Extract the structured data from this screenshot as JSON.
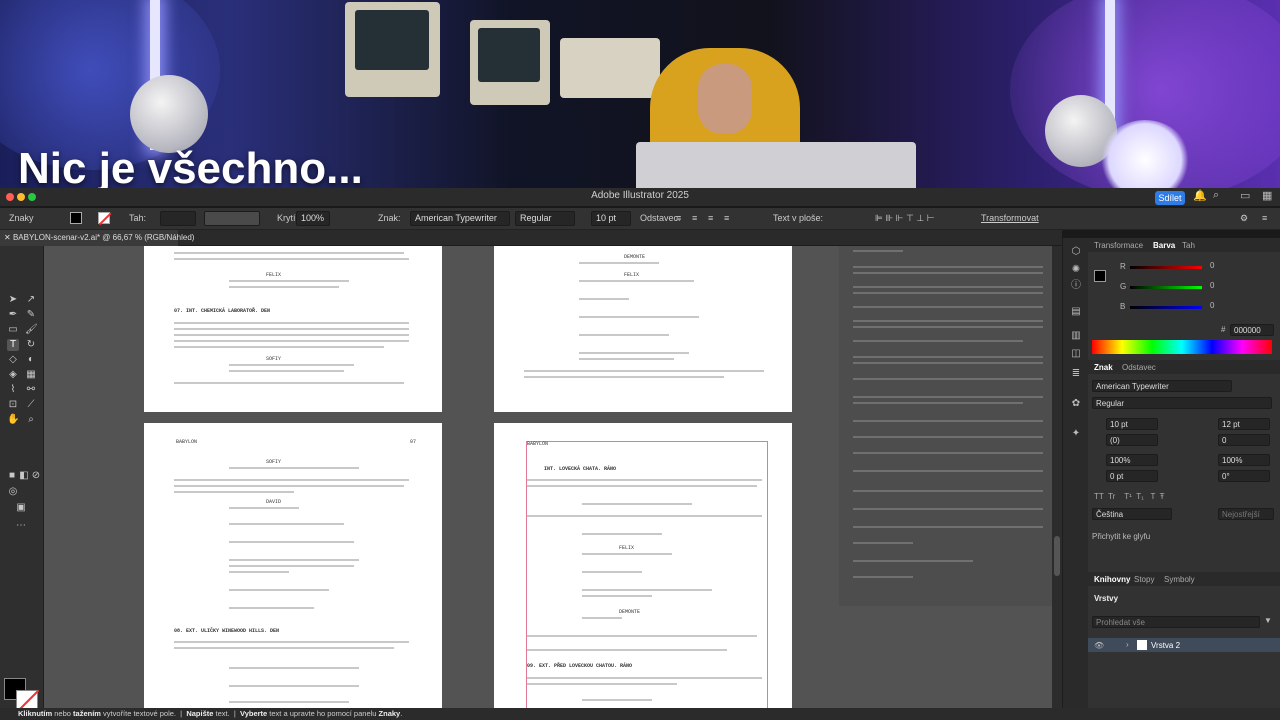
{
  "overlay": {
    "caption": "Nic je všechno..."
  },
  "window": {
    "title": "Adobe Illustrator 2025",
    "share_label": "Sdílet"
  },
  "control_bar": {
    "panel_name": "Znaky",
    "stroke_label": "Tah:",
    "opacity_label": "Krytí:",
    "opacity_value": "100%",
    "char_label": "Znak:",
    "font_name": "American Typewriter",
    "font_style": "Regular",
    "font_size": "10 pt",
    "paragraph_label": "Odstavec:",
    "area_text_label": "Text v ploše:",
    "transform_label": "Transformovat"
  },
  "document": {
    "tab_title": "BABYLON-scenar-v2.ai* @ 66,67 % (RGB/Náhled)"
  },
  "script_pages": {
    "p1_scene": "07.   INT. CHEMICKÁ LABORATOŘ. DEN",
    "p1_char1": "FELIX",
    "p1_char2": "SOFIY",
    "p2_char1": "DEMONTE",
    "p2_char2": "FELIX",
    "p3_header": "BABYLON",
    "p3_page": "07",
    "p3_char1": "SOFIY",
    "p3_char2": "DAVID",
    "p3_scene": "08.   EXT. ULIČKY WINEWOOD HILLS. DEN",
    "p4_header": "BABYLON",
    "p4_scene": "INT. LOVECKÁ CHATA. RÁNO",
    "p4_char1": "FELIX",
    "p4_char2": "DEMONTE",
    "p4_scene2": "09.   EXT. PŘED LOVECKOU CHATOU. RÁNO"
  },
  "panels": {
    "tabs": [
      "Transformace",
      "Barva",
      "Tah"
    ],
    "color": {
      "r_label": "R",
      "g_label": "G",
      "b_label": "B",
      "r": "0",
      "g": "0",
      "b": "0",
      "hex_prefix": "#",
      "hex": "000000"
    },
    "type_tabs": [
      "Znak",
      "Odstavec"
    ],
    "character": {
      "font": "American Typewriter",
      "style": "Regular",
      "size": "10 pt",
      "leading": "12 pt",
      "kerning": "(0)",
      "tracking": "0",
      "v_scale": "100%",
      "h_scale": "100%",
      "baseline": "0 pt",
      "rotation": "0°",
      "language": "Čeština",
      "antialias": "Nejostřejší",
      "snap_label": "Přichytit ke glyfu"
    },
    "library_tabs": [
      "Knihovny",
      "Stopy",
      "Symboly"
    ],
    "layers": {
      "title": "Vrstvy",
      "search_placeholder": "Prohledat vše",
      "layer_name": "Vrstva 2"
    }
  },
  "status": {
    "part1_bold": "Kliknutím",
    "part2": " nebo ",
    "part3_bold": "tažením",
    "part4": " vytvoříte textové pole.",
    "part5_bold": "Napište",
    "part6": " text.",
    "part7_bold": "Vyberte",
    "part8": " text a upravte ho pomocí panelu ",
    "part9_bold": "Znaky",
    "part10": "."
  },
  "colors": {
    "accent": "#2f7ce6",
    "artboard_border": "#e07a96",
    "canvas": "#535353"
  }
}
